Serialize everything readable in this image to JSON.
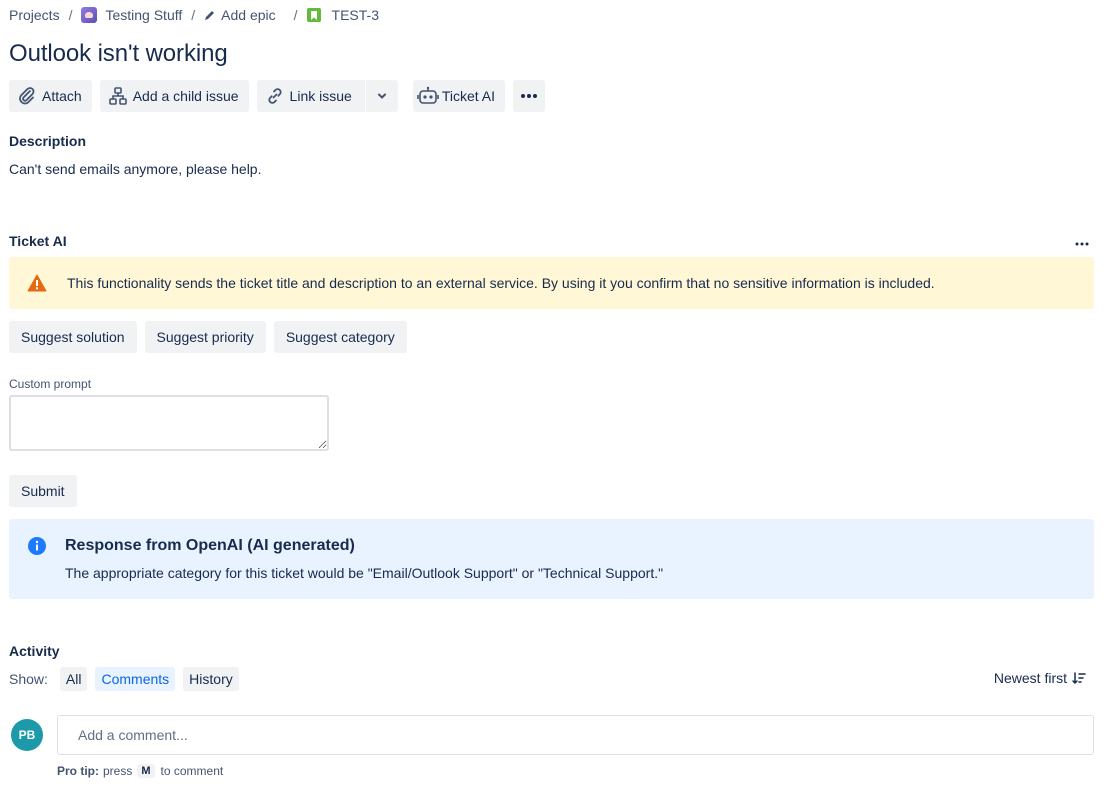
{
  "breadcrumb": {
    "projects": "Projects",
    "project": "Testing Stuff",
    "epic": "Add epic",
    "issue_key": "TEST-3"
  },
  "issue": {
    "title": "Outlook isn't working"
  },
  "toolbar": {
    "attach": "Attach",
    "add_child": "Add a child issue",
    "link_issue": "Link issue",
    "ticket_ai": "Ticket AI"
  },
  "description": {
    "heading": "Description",
    "text": "Can't send emails anymore, please help."
  },
  "ticket_ai": {
    "heading": "Ticket AI",
    "warning": "This functionality sends the ticket title and description to an external service. By using it you confirm that no sensitive information is included.",
    "suggest_solution": "Suggest solution",
    "suggest_priority": "Suggest priority",
    "suggest_category": "Suggest category",
    "custom_prompt_label": "Custom prompt",
    "custom_prompt_value": "",
    "submit": "Submit",
    "response_title": "Response from OpenAI (AI generated)",
    "response_body": "The appropriate category for this ticket would be \"Email/Outlook Support\" or \"Technical Support.\""
  },
  "activity": {
    "heading": "Activity",
    "show_label": "Show:",
    "filters": [
      "All",
      "Comments",
      "History"
    ],
    "active_filter": "Comments",
    "sort": "Newest first",
    "avatar_initials": "PB",
    "comment_placeholder": "Add a comment...",
    "protip_label": "Pro tip:",
    "protip_press": "press",
    "protip_key": "M",
    "protip_rest": "to comment"
  },
  "colors": {
    "accent": "#0c66e4",
    "warning_bg": "#fff7d6",
    "warning_icon": "#e56910",
    "info_bg": "#e9f2ff",
    "info_icon": "#1d7afc",
    "avatar": "#1d9aaa",
    "story": "#63ba3c"
  },
  "icons": [
    "project-icon",
    "pencil-icon",
    "story-icon",
    "paperclip-icon",
    "hierarchy-icon",
    "link-icon",
    "chevron-down-icon",
    "robot-icon",
    "more-icon",
    "warning-icon",
    "info-icon",
    "sort-icon"
  ]
}
